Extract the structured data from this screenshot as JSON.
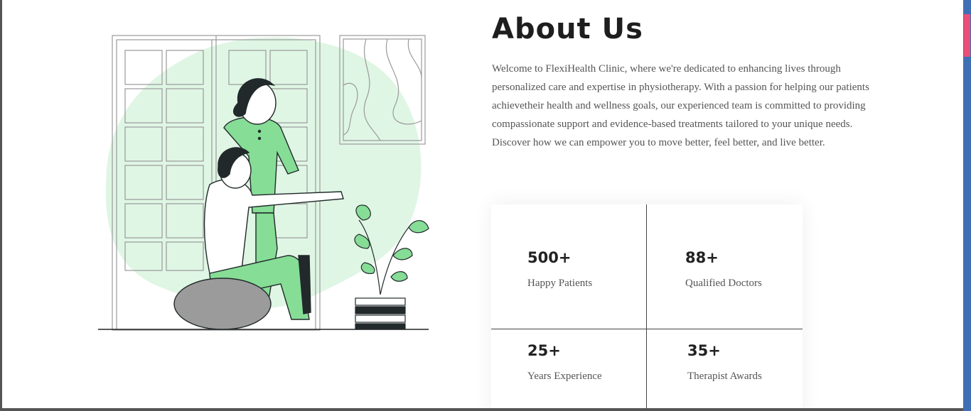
{
  "about": {
    "title": "About Us",
    "intro": "Welcome to FlexiHealth Clinic, where we're dedicated to enhancing lives through personalized care and expertise in physiotherapy. With a passion for helping our patients achievetheir health and wellness goals, our experienced team is committed to providing compassionate support and evidence-based treatments tailored to your unique needs. Discover how we can empower you to move better, feel better, and live better."
  },
  "stats": [
    {
      "value": "500+",
      "label": "Happy Patients"
    },
    {
      "value": "88+",
      "label": "Qualified Doctors"
    },
    {
      "value": "25+",
      "label": "Years Experience"
    },
    {
      "value": "35+",
      "label": "Therapist Awards"
    }
  ],
  "illustration": {
    "icon": "physiotherapy-illustration-icon"
  },
  "colors": {
    "accent_green": "#86dd96",
    "blob": "#dff6e4",
    "dark": "#22292b",
    "ball": "#9b9b9b"
  }
}
